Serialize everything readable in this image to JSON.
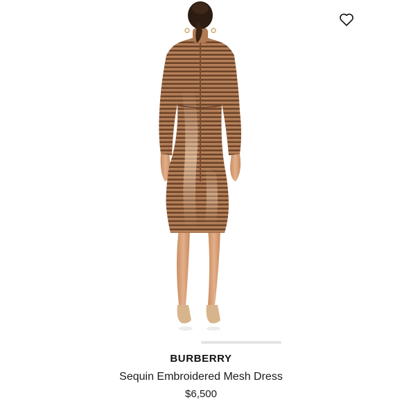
{
  "product": {
    "brand": "BURBERRY",
    "title": "Sequin Embroidered Mesh Dress",
    "price": "$6,500"
  },
  "icons": {
    "wishlist": "heart-outline-icon"
  },
  "carousel": {
    "current_slide": 2
  },
  "colors": {
    "dress": "#a8714a",
    "background": "#ffffff",
    "text": "#111111",
    "indicator": "#e4e4e4"
  }
}
